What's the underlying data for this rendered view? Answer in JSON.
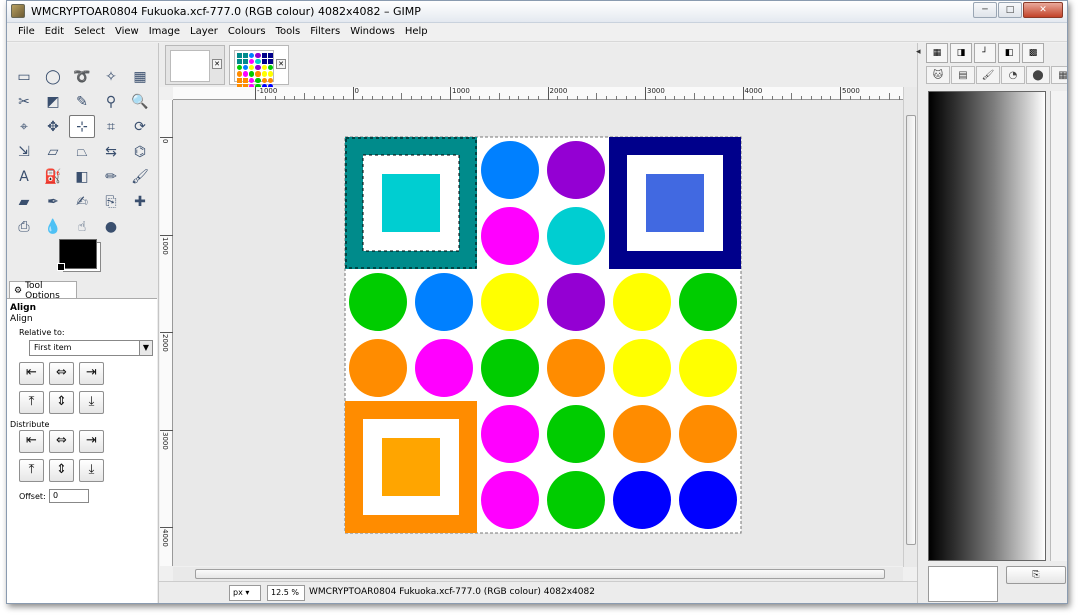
{
  "window": {
    "title": "WMCRYPTOAR0804 Fukuoka.xcf-777.0 (RGB colour) 4082x4082 – GIMP",
    "controls": {
      "minimize": "─",
      "maximize": "□",
      "close": "✕"
    }
  },
  "menu": [
    "File",
    "Edit",
    "Select",
    "View",
    "Image",
    "Layer",
    "Colours",
    "Tools",
    "Filters",
    "Windows",
    "Help"
  ],
  "toolbox": {
    "tools": [
      {
        "name": "rect-select-tool-icon",
        "glyph": "▭"
      },
      {
        "name": "ellipse-select-tool-icon",
        "glyph": "◯"
      },
      {
        "name": "free-select-tool-icon",
        "glyph": "➰"
      },
      {
        "name": "fuzzy-select-tool-icon",
        "glyph": "✧"
      },
      {
        "name": "by-color-select-tool-icon",
        "glyph": "▦"
      },
      {
        "name": "scissors-select-tool-icon",
        "glyph": "✂"
      },
      {
        "name": "foreground-select-tool-icon",
        "glyph": "◩"
      },
      {
        "name": "paths-tool-icon",
        "glyph": "✎"
      },
      {
        "name": "color-picker-tool-icon",
        "glyph": "⚲"
      },
      {
        "name": "zoom-tool-icon",
        "glyph": "🔍"
      },
      {
        "name": "measure-tool-icon",
        "glyph": "⌖"
      },
      {
        "name": "move-tool-icon",
        "glyph": "✥"
      },
      {
        "name": "align-tool-icon",
        "glyph": "⊹"
      },
      {
        "name": "crop-tool-icon",
        "glyph": "⌗"
      },
      {
        "name": "rotate-tool-icon",
        "glyph": "⟳"
      },
      {
        "name": "scale-tool-icon",
        "glyph": "⇲"
      },
      {
        "name": "shear-tool-icon",
        "glyph": "▱"
      },
      {
        "name": "perspective-tool-icon",
        "glyph": "⏢"
      },
      {
        "name": "flip-tool-icon",
        "glyph": "⇆"
      },
      {
        "name": "cage-tool-icon",
        "glyph": "⌬"
      },
      {
        "name": "text-tool-icon",
        "glyph": "A"
      },
      {
        "name": "bucket-fill-tool-icon",
        "glyph": "⛽"
      },
      {
        "name": "blend-tool-icon",
        "glyph": "◧"
      },
      {
        "name": "pencil-tool-icon",
        "glyph": "✏"
      },
      {
        "name": "paintbrush-tool-icon",
        "glyph": "🖌"
      },
      {
        "name": "eraser-tool-icon",
        "glyph": "▰"
      },
      {
        "name": "airbrush-tool-icon",
        "glyph": "✒"
      },
      {
        "name": "ink-tool-icon",
        "glyph": "✍"
      },
      {
        "name": "clone-tool-icon",
        "glyph": "⎘"
      },
      {
        "name": "heal-tool-icon",
        "glyph": "✚"
      },
      {
        "name": "perspective-clone-tool-icon",
        "glyph": "⎙"
      },
      {
        "name": "blur-tool-icon",
        "glyph": "💧"
      },
      {
        "name": "smudge-tool-icon",
        "glyph": "☝"
      },
      {
        "name": "dodge-burn-tool-icon",
        "glyph": "●"
      }
    ],
    "active_tool_index": 12,
    "tool_options_tab": "Tool Options"
  },
  "tool_options": {
    "title": "Align",
    "subtitle": "Align",
    "relative_to_label": "Relative to:",
    "relative_to_value": "First item",
    "distribute_label": "Distribute",
    "offset_label": "Offset:",
    "offset_value": "0",
    "align_buttons": [
      "⇤",
      "⇔",
      "⇥",
      "⤒",
      "⇕",
      "⤓"
    ],
    "distribute_buttons": [
      "⇤",
      "⇔",
      "⇥",
      "⤒",
      "⇕",
      "⤓"
    ]
  },
  "rulers": {
    "h_labels": [
      "-1000",
      "0",
      "1000",
      "2000",
      "3000",
      "4000",
      "5000"
    ],
    "v_labels": [
      "0",
      "1000",
      "2000",
      "3000",
      "4000"
    ]
  },
  "image": {
    "colors": {
      "teal": "#008b8b",
      "cyan": "#00ced1",
      "navy": "#00008b",
      "royal": "#4169e1",
      "orange": "#ff8c00",
      "orange_light": "#ffa500",
      "blue": "#0000ff",
      "azure": "#0080ff",
      "purple": "#9400d3",
      "magenta": "#ff00ff",
      "green": "#00cc00",
      "yellow": "#ffff00"
    },
    "circles": [
      [
        "",
        "",
        "azure",
        "purple",
        "",
        ""
      ],
      [
        "",
        "",
        "magenta",
        "cyan",
        "",
        ""
      ],
      [
        "green",
        "azure",
        "yellow",
        "purple",
        "yellow",
        "green"
      ],
      [
        "orange",
        "magenta",
        "green",
        "orange",
        "yellow",
        "yellow"
      ],
      [
        "",
        "",
        "magenta",
        "green",
        "orange",
        "orange"
      ],
      [
        "",
        "",
        "magenta",
        "green",
        "blue",
        "blue"
      ]
    ],
    "squares": [
      {
        "row": 0,
        "col": 0,
        "frame": "teal",
        "inner": "cyan",
        "selected": true
      },
      {
        "row": 0,
        "col": 4,
        "frame": "navy",
        "inner": "royal",
        "selected": false
      },
      {
        "row": 4,
        "col": 0,
        "frame": "orange",
        "inner": "orange_light",
        "selected": false
      }
    ]
  },
  "statusbar": {
    "unit": "px",
    "zoom": "12.5 %",
    "message": "WMCRYPTOAR0804 Fukuoka.xcf-777.0 (RGB colour) 4082x4082"
  },
  "dock": {
    "top_tabs": [
      "▦",
      "◨",
      "┘",
      "◧",
      "▩"
    ],
    "sub_tabs": [
      "🐱",
      "▤",
      "🖌",
      "◔",
      "⬤",
      "▦"
    ],
    "button_icon": "⎘"
  }
}
